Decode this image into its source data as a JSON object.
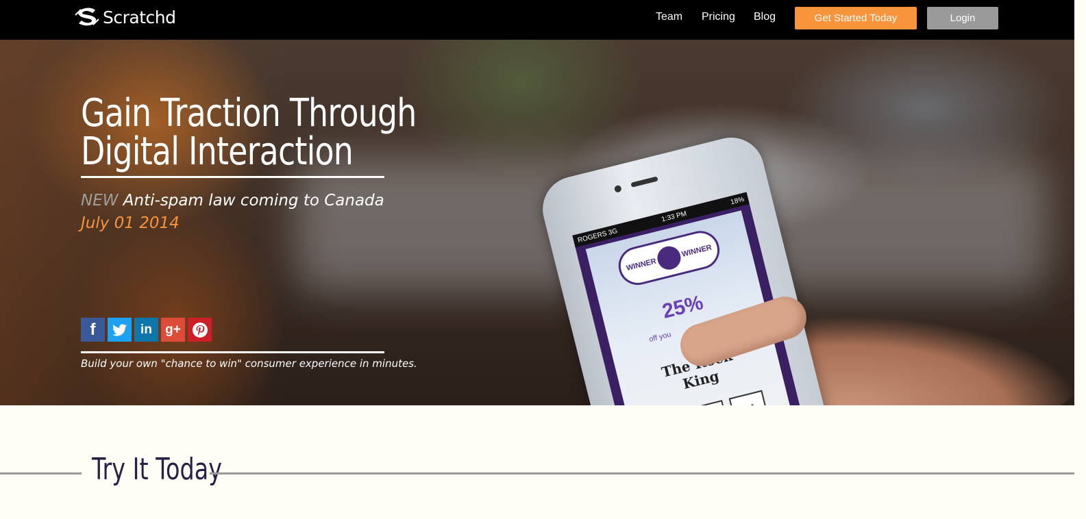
{
  "brand": {
    "name": "Scratchd"
  },
  "nav": {
    "links": [
      "Team",
      "Pricing",
      "Blog"
    ],
    "cta": "Get Started Today",
    "login": "Login"
  },
  "hero": {
    "headline_line1": "Gain Traction Through",
    "headline_line2": "Digital Interaction",
    "news_tag": "NEW",
    "news_text": "Anti-spam law coming to Canada",
    "news_date": "July 01 2014",
    "social": [
      "facebook-icon",
      "twitter-icon",
      "linkedin-icon",
      "google-plus-icon",
      "pinterest-icon"
    ],
    "tagline": "Build your own \"chance to win\" consumer experience in minutes."
  },
  "phone": {
    "carrier": "ROGERS 3G",
    "time": "1:33 PM",
    "battery": "18%",
    "badge_left": "WINNER",
    "badge_right": "WINNER",
    "discount": "25%",
    "discount_sub": "off you",
    "prize_line1": "The Rock",
    "prize_line2": "King"
  },
  "section": {
    "title": "Try It Today"
  },
  "colors": {
    "accent": "#f7943c",
    "login_bg": "#9a9a9a",
    "topbar": "#000000",
    "section_bg": "#fffef6"
  }
}
